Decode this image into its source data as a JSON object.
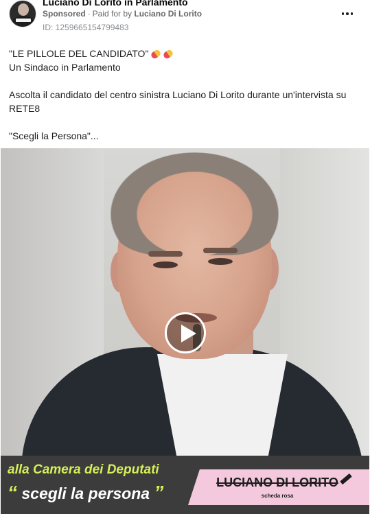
{
  "header": {
    "page_name": "Luciano Di Lorito in Parlamento",
    "sponsored": "Sponsored",
    "separator": "·",
    "paid_for_prefix": "Paid for by",
    "paid_for_name": "Luciano Di Lorito",
    "ad_id": "ID: 1259665154799483",
    "more_icon": "more-horizontal-icon"
  },
  "post": {
    "line1": "\"LE PILLOLE DEL CANDIDATO\"",
    "line2": "Un Sindaco in Parlamento",
    "line3": "Ascolta il candidato del centro sinistra Luciano Di Lorito durante un'intervista su RETE8",
    "line4": "\"Scegli la Persona\"..."
  },
  "video": {
    "play_icon": "play-icon",
    "banner_line1": "alla Camera dei Deputati",
    "banner_line2": "scegli la persona",
    "open_quote": "“",
    "close_quote": "”",
    "name_card": "LUCIANO DI LORITO",
    "name_card_sub": "scheda rosa",
    "colors": {
      "banner_bg": "#3c3c3c",
      "accent": "#d6ef58",
      "name_card_bg": "#f4c9dd"
    }
  }
}
